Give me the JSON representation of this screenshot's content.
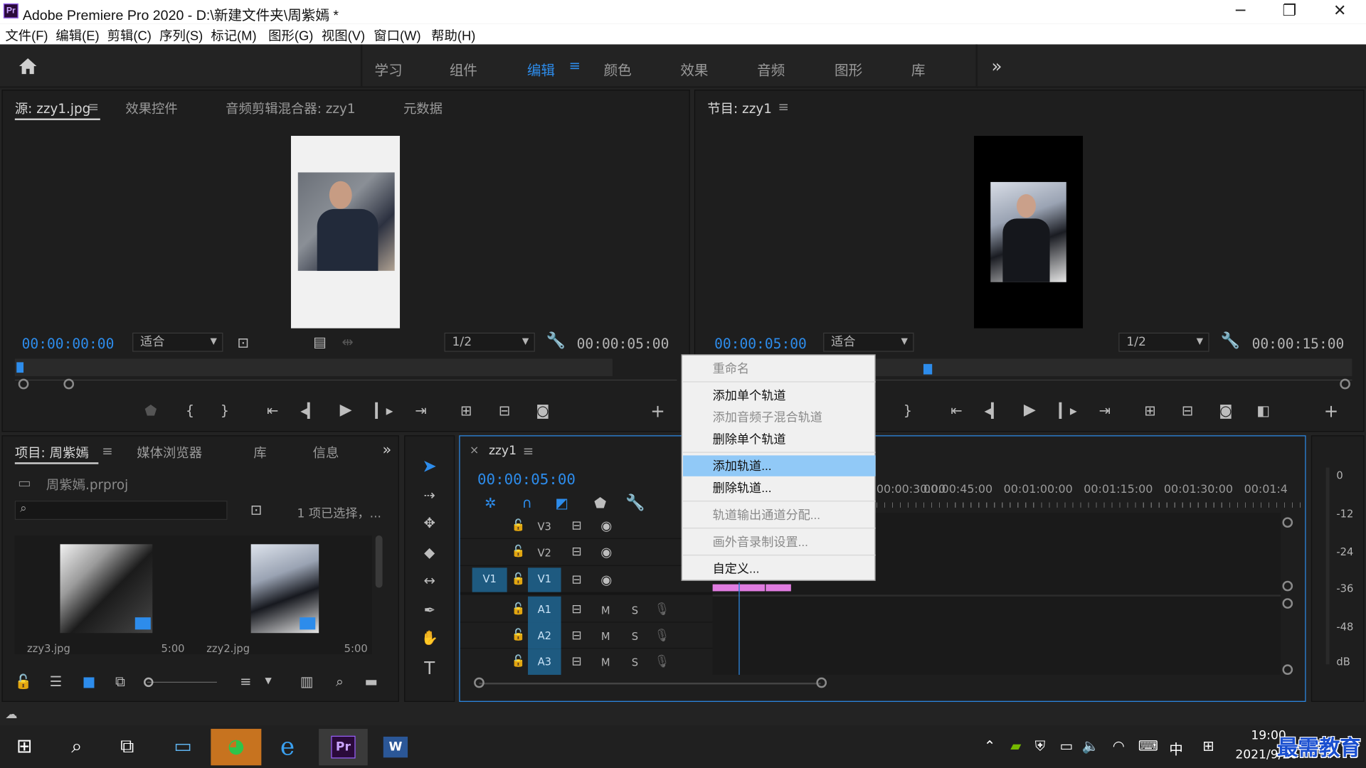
{
  "app": {
    "title": "Adobe Premiere Pro 2020 - D:\\新建文件夹\\周紫嫣 *",
    "logo_text": "Pr",
    "window_controls": [
      "minimize-icon",
      "restore-icon",
      "close-icon"
    ]
  },
  "menu": [
    "文件(F)",
    "编辑(E)",
    "剪辑(C)",
    "序列(S)",
    "标记(M)",
    "图形(G)",
    "视图(V)",
    "窗口(W)",
    "帮助(H)"
  ],
  "workspaces": {
    "items": [
      "学习",
      "组件",
      "编辑",
      "颜色",
      "效果",
      "音频",
      "图形",
      "库"
    ],
    "active": "编辑",
    "overflow": "»"
  },
  "source_monitor": {
    "tabs": [
      "源: zzy1.jpg",
      "效果控件",
      "音频剪辑混合器: zzy1",
      "元数据"
    ],
    "timecode_in": "00:00:00:00",
    "fit": "适合",
    "resolution": "1/2",
    "duration": "00:00:05:00"
  },
  "program_monitor": {
    "tab": "节目: zzy1",
    "timecode": "00:00:05:00",
    "fit": "适合",
    "resolution": "1/2",
    "duration": "00:00:15:00"
  },
  "project_panel": {
    "tabs": [
      "项目: 周紫嫣",
      "媒体浏览器",
      "库",
      "信息"
    ],
    "project_file": "周紫嫣.prproj",
    "selection_info": "1 项已选择，...",
    "items": [
      {
        "name": "zzy3.jpg",
        "duration": "5:00"
      },
      {
        "name": "zzy2.jpg",
        "duration": "5:00"
      }
    ]
  },
  "timeline": {
    "sequence": "zzy1",
    "timecode": "00:00:05:00",
    "ruler": [
      "00:00:30:00",
      "00:00:45:00",
      "00:01:00:00",
      "00:01:15:00",
      "00:01:30:00",
      "00:01:4"
    ],
    "video_tracks": [
      "V3",
      "V2",
      "V1"
    ],
    "audio_tracks": [
      "A1",
      "A2",
      "A3"
    ],
    "source_patch": "V1",
    "mute": "M",
    "solo": "S"
  },
  "audio_meter": {
    "scale": [
      "0",
      "-12",
      "-24",
      "-36",
      "-48",
      "dB"
    ]
  },
  "context_menu": {
    "items": [
      {
        "label": "重命名",
        "enabled": false
      },
      {
        "label": "添加单个轨道",
        "enabled": true
      },
      {
        "label": "添加音频子混合轨道",
        "enabled": false
      },
      {
        "label": "删除单个轨道",
        "enabled": true
      },
      {
        "label": "添加轨道...",
        "enabled": true,
        "highlighted": true
      },
      {
        "label": "删除轨道...",
        "enabled": true
      },
      {
        "label": "轨道输出通道分配...",
        "enabled": false
      },
      {
        "label": "画外音录制设置...",
        "enabled": false
      },
      {
        "label": "自定义...",
        "enabled": true
      }
    ]
  },
  "taskbar": {
    "time": "19:00",
    "date": "2021/9/26",
    "ime": "中",
    "watermark": "最需教育"
  },
  "colors": {
    "accent_blue": "#2d8ceb",
    "clip_pink": "#e07ce0",
    "menu_highlight": "#91c9f7",
    "panel_bg": "#1e1e1e"
  }
}
